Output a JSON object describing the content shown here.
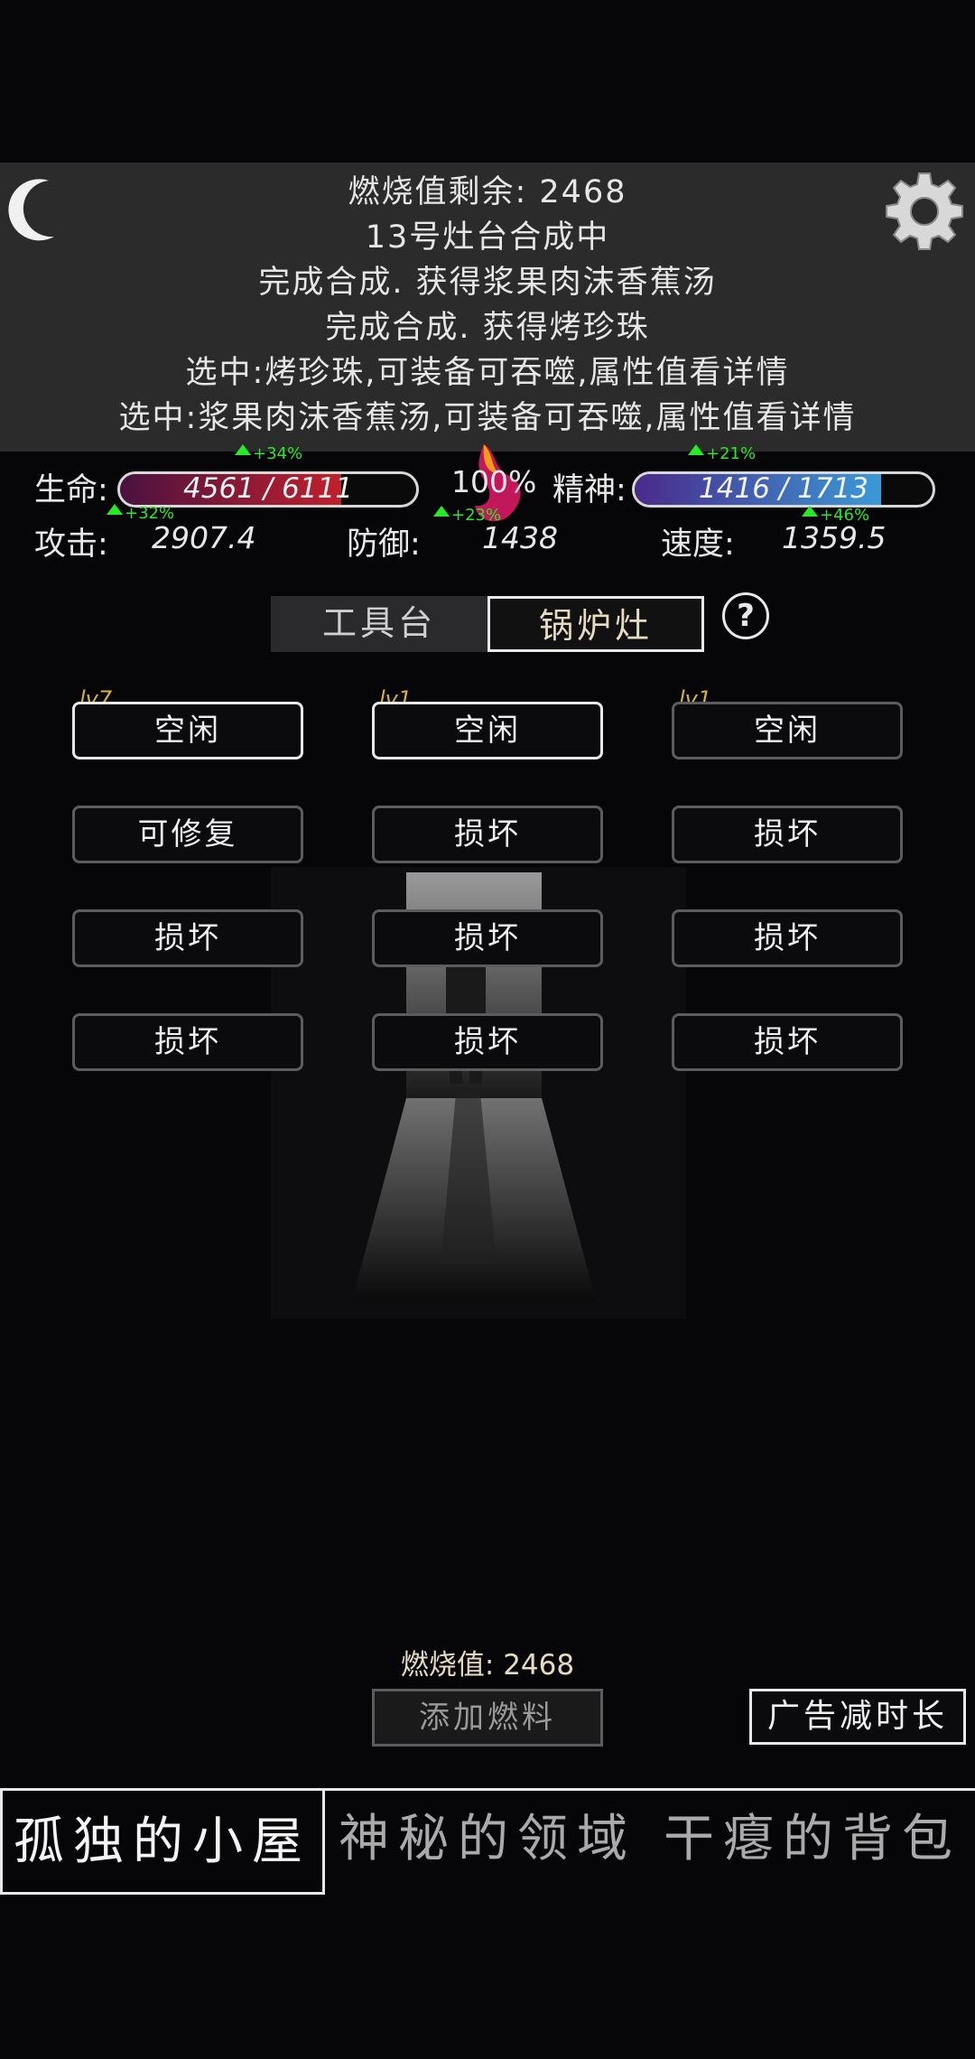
{
  "log": {
    "burn_remaining": "燃烧值剩余: 2468",
    "lines": [
      "13号灶台合成中",
      "完成合成. 获得浆果肉沫香蕉汤",
      "完成合成. 获得烤珍珠",
      "选中:烤珍珠,可装备可吞噬,属性值看详情",
      "选中:浆果肉沫香蕉汤,可装备可吞噬,属性值看详情"
    ]
  },
  "stats": {
    "hp_label": "生命:",
    "hp_text": "4561 / 6111",
    "hp_fraction": 0.746,
    "hp_buff": "+34%",
    "mp_label": "精神:",
    "mp_text": "1416 / 1713",
    "mp_fraction": 0.827,
    "mp_buff": "+21%",
    "center_percent": "100%",
    "atk_label": "攻击:",
    "atk_value": "2907.4",
    "atk_buff": "+32%",
    "def_label": "防御:",
    "def_value": "1438",
    "def_buff": "+23%",
    "spd_label": "速度:",
    "spd_value": "1359.5",
    "spd_buff": "+46%"
  },
  "tabs": {
    "workbench": "工具台",
    "stove": "锅炉灶",
    "help": "?"
  },
  "slots": {
    "levels": [
      "lv7",
      "lv1",
      "lv1"
    ],
    "rows": [
      [
        "空闲",
        "空闲",
        "空闲"
      ],
      [
        "可修复",
        "损坏",
        "损坏"
      ],
      [
        "损坏",
        "损坏",
        "损坏"
      ],
      [
        "损坏",
        "损坏",
        "损坏"
      ]
    ]
  },
  "bottom": {
    "burn_value": "燃烧值: 2468",
    "add_fuel": "添加燃料",
    "ad_button": "广告减时长"
  },
  "nav": {
    "cabin": "孤独的小屋",
    "realm": "神秘的领域",
    "bag": "干瘪的背包"
  },
  "colors": {
    "hp_bar": "#c0202c",
    "mp_bar": "#3a9ad8",
    "buff_green": "#27e927",
    "level_gold": "#d8b23c"
  }
}
